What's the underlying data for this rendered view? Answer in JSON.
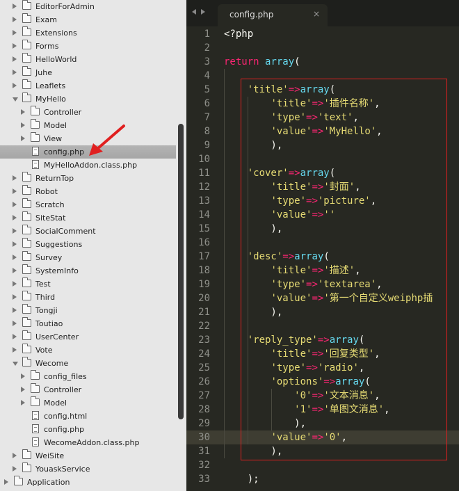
{
  "sidebar": {
    "items": [
      {
        "label": "EditorForAdmin",
        "type": "folder",
        "state": "closed",
        "depth": 1
      },
      {
        "label": "Exam",
        "type": "folder",
        "state": "closed",
        "depth": 1
      },
      {
        "label": "Extensions",
        "type": "folder",
        "state": "closed",
        "depth": 1
      },
      {
        "label": "Forms",
        "type": "folder",
        "state": "closed",
        "depth": 1
      },
      {
        "label": "HelloWorld",
        "type": "folder",
        "state": "closed",
        "depth": 1
      },
      {
        "label": "Juhe",
        "type": "folder",
        "state": "closed",
        "depth": 1
      },
      {
        "label": "Leaflets",
        "type": "folder",
        "state": "closed",
        "depth": 1
      },
      {
        "label": "MyHello",
        "type": "folder",
        "state": "open",
        "depth": 1
      },
      {
        "label": "Controller",
        "type": "folder",
        "state": "closed",
        "depth": 2
      },
      {
        "label": "Model",
        "type": "folder",
        "state": "closed",
        "depth": 2
      },
      {
        "label": "View",
        "type": "folder",
        "state": "closed",
        "depth": 2
      },
      {
        "label": "config.php",
        "type": "file",
        "depth": 2,
        "selected": true
      },
      {
        "label": "MyHelloAddon.class.php",
        "type": "file",
        "depth": 2
      },
      {
        "label": "ReturnTop",
        "type": "folder",
        "state": "closed",
        "depth": 1
      },
      {
        "label": "Robot",
        "type": "folder",
        "state": "closed",
        "depth": 1
      },
      {
        "label": "Scratch",
        "type": "folder",
        "state": "closed",
        "depth": 1
      },
      {
        "label": "SiteStat",
        "type": "folder",
        "state": "closed",
        "depth": 1
      },
      {
        "label": "SocialComment",
        "type": "folder",
        "state": "closed",
        "depth": 1
      },
      {
        "label": "Suggestions",
        "type": "folder",
        "state": "closed",
        "depth": 1
      },
      {
        "label": "Survey",
        "type": "folder",
        "state": "closed",
        "depth": 1
      },
      {
        "label": "SystemInfo",
        "type": "folder",
        "state": "closed",
        "depth": 1
      },
      {
        "label": "Test",
        "type": "folder",
        "state": "closed",
        "depth": 1
      },
      {
        "label": "Third",
        "type": "folder",
        "state": "closed",
        "depth": 1
      },
      {
        "label": "Tongji",
        "type": "folder",
        "state": "closed",
        "depth": 1
      },
      {
        "label": "Toutiao",
        "type": "folder",
        "state": "closed",
        "depth": 1
      },
      {
        "label": "UserCenter",
        "type": "folder",
        "state": "closed",
        "depth": 1
      },
      {
        "label": "Vote",
        "type": "folder",
        "state": "closed",
        "depth": 1
      },
      {
        "label": "Wecome",
        "type": "folder",
        "state": "open",
        "depth": 1
      },
      {
        "label": "config_files",
        "type": "folder",
        "state": "closed",
        "depth": 2
      },
      {
        "label": "Controller",
        "type": "folder",
        "state": "closed",
        "depth": 2
      },
      {
        "label": "Model",
        "type": "folder",
        "state": "closed",
        "depth": 2
      },
      {
        "label": "config.html",
        "type": "file",
        "depth": 2
      },
      {
        "label": "config.php",
        "type": "file",
        "depth": 2
      },
      {
        "label": "WecomeAddon.class.php",
        "type": "file",
        "depth": 2
      },
      {
        "label": "WeiSite",
        "type": "folder",
        "state": "closed",
        "depth": 1
      },
      {
        "label": "YouaskService",
        "type": "folder",
        "state": "closed",
        "depth": 1
      },
      {
        "label": "Application",
        "type": "folder",
        "state": "closed",
        "depth": 0
      }
    ]
  },
  "tab": {
    "label": "config.php",
    "close": "×"
  },
  "editor": {
    "highlighted_line": 30,
    "lines": [
      {
        "n": "1",
        "tokens": [
          [
            "plain",
            "<?php"
          ]
        ]
      },
      {
        "n": "2",
        "tokens": []
      },
      {
        "n": "3",
        "tokens": [
          [
            "kw",
            "return "
          ],
          [
            "fn",
            "array"
          ],
          [
            "plain",
            "("
          ]
        ]
      },
      {
        "n": "4",
        "tokens": []
      },
      {
        "n": "5",
        "tokens": [
          [
            "plain",
            "    "
          ],
          [
            "str",
            "'title'"
          ],
          [
            "op",
            "=>"
          ],
          [
            "fn",
            "array"
          ],
          [
            "plain",
            "("
          ]
        ]
      },
      {
        "n": "6",
        "tokens": [
          [
            "plain",
            "        "
          ],
          [
            "str",
            "'title'"
          ],
          [
            "op",
            "=>"
          ],
          [
            "str",
            "'插件名称'"
          ],
          [
            "plain",
            ","
          ]
        ]
      },
      {
        "n": "7",
        "tokens": [
          [
            "plain",
            "        "
          ],
          [
            "str",
            "'type'"
          ],
          [
            "op",
            "=>"
          ],
          [
            "str",
            "'text'"
          ],
          [
            "plain",
            ","
          ]
        ]
      },
      {
        "n": "8",
        "tokens": [
          [
            "plain",
            "        "
          ],
          [
            "str",
            "'value'"
          ],
          [
            "op",
            "=>"
          ],
          [
            "str",
            "'MyHello'"
          ],
          [
            "plain",
            ","
          ]
        ]
      },
      {
        "n": "9",
        "tokens": [
          [
            "plain",
            "        ),"
          ]
        ]
      },
      {
        "n": "10",
        "tokens": []
      },
      {
        "n": "11",
        "tokens": [
          [
            "plain",
            "    "
          ],
          [
            "str",
            "'cover'"
          ],
          [
            "op",
            "=>"
          ],
          [
            "fn",
            "array"
          ],
          [
            "plain",
            "("
          ]
        ]
      },
      {
        "n": "12",
        "tokens": [
          [
            "plain",
            "        "
          ],
          [
            "str",
            "'title'"
          ],
          [
            "op",
            "=>"
          ],
          [
            "str",
            "'封面'"
          ],
          [
            "plain",
            ","
          ]
        ]
      },
      {
        "n": "13",
        "tokens": [
          [
            "plain",
            "        "
          ],
          [
            "str",
            "'type'"
          ],
          [
            "op",
            "=>"
          ],
          [
            "str",
            "'picture'"
          ],
          [
            "plain",
            ","
          ]
        ]
      },
      {
        "n": "14",
        "tokens": [
          [
            "plain",
            "        "
          ],
          [
            "str",
            "'value'"
          ],
          [
            "op",
            "=>"
          ],
          [
            "str",
            "''"
          ]
        ]
      },
      {
        "n": "15",
        "tokens": [
          [
            "plain",
            "        ),"
          ]
        ]
      },
      {
        "n": "16",
        "tokens": []
      },
      {
        "n": "17",
        "tokens": [
          [
            "plain",
            "    "
          ],
          [
            "str",
            "'desc'"
          ],
          [
            "op",
            "=>"
          ],
          [
            "fn",
            "array"
          ],
          [
            "plain",
            "("
          ]
        ]
      },
      {
        "n": "18",
        "tokens": [
          [
            "plain",
            "        "
          ],
          [
            "str",
            "'title'"
          ],
          [
            "op",
            "=>"
          ],
          [
            "str",
            "'描述'"
          ],
          [
            "plain",
            ","
          ]
        ]
      },
      {
        "n": "19",
        "tokens": [
          [
            "plain",
            "        "
          ],
          [
            "str",
            "'type'"
          ],
          [
            "op",
            "=>"
          ],
          [
            "str",
            "'textarea'"
          ],
          [
            "plain",
            ","
          ]
        ]
      },
      {
        "n": "20",
        "tokens": [
          [
            "plain",
            "        "
          ],
          [
            "str",
            "'value'"
          ],
          [
            "op",
            "=>"
          ],
          [
            "str",
            "'第一个自定义weiphp插"
          ]
        ]
      },
      {
        "n": "21",
        "tokens": [
          [
            "plain",
            "        ),"
          ]
        ]
      },
      {
        "n": "22",
        "tokens": []
      },
      {
        "n": "23",
        "tokens": [
          [
            "plain",
            "    "
          ],
          [
            "str",
            "'reply_type'"
          ],
          [
            "op",
            "=>"
          ],
          [
            "fn",
            "array"
          ],
          [
            "plain",
            "("
          ]
        ]
      },
      {
        "n": "24",
        "tokens": [
          [
            "plain",
            "        "
          ],
          [
            "str",
            "'title'"
          ],
          [
            "op",
            "=>"
          ],
          [
            "str",
            "'回复类型'"
          ],
          [
            "plain",
            ","
          ]
        ]
      },
      {
        "n": "25",
        "tokens": [
          [
            "plain",
            "        "
          ],
          [
            "str",
            "'type'"
          ],
          [
            "op",
            "=>"
          ],
          [
            "str",
            "'radio'"
          ],
          [
            "plain",
            ","
          ]
        ]
      },
      {
        "n": "26",
        "tokens": [
          [
            "plain",
            "        "
          ],
          [
            "str",
            "'options'"
          ],
          [
            "op",
            "=>"
          ],
          [
            "fn",
            "array"
          ],
          [
            "plain",
            "("
          ]
        ]
      },
      {
        "n": "27",
        "tokens": [
          [
            "plain",
            "            "
          ],
          [
            "str",
            "'0'"
          ],
          [
            "op",
            "=>"
          ],
          [
            "str",
            "'文本消息'"
          ],
          [
            "plain",
            ","
          ]
        ]
      },
      {
        "n": "28",
        "tokens": [
          [
            "plain",
            "            "
          ],
          [
            "str",
            "'1'"
          ],
          [
            "op",
            "=>"
          ],
          [
            "str",
            "'单图文消息'"
          ],
          [
            "plain",
            ","
          ]
        ]
      },
      {
        "n": "29",
        "tokens": [
          [
            "plain",
            "            ),"
          ]
        ]
      },
      {
        "n": "30",
        "tokens": [
          [
            "plain",
            "        "
          ],
          [
            "str",
            "'value'"
          ],
          [
            "op",
            "=>"
          ],
          [
            "str",
            "'0'"
          ],
          [
            "plain",
            ","
          ]
        ]
      },
      {
        "n": "31",
        "tokens": [
          [
            "plain",
            "        ),"
          ]
        ]
      },
      {
        "n": "32",
        "tokens": []
      },
      {
        "n": "33",
        "tokens": [
          [
            "plain",
            "    );"
          ]
        ]
      }
    ]
  },
  "colors": {
    "accent_annotation": "#e02020",
    "editor_bg": "#272822",
    "sidebar_bg": "#e7e7e7"
  }
}
